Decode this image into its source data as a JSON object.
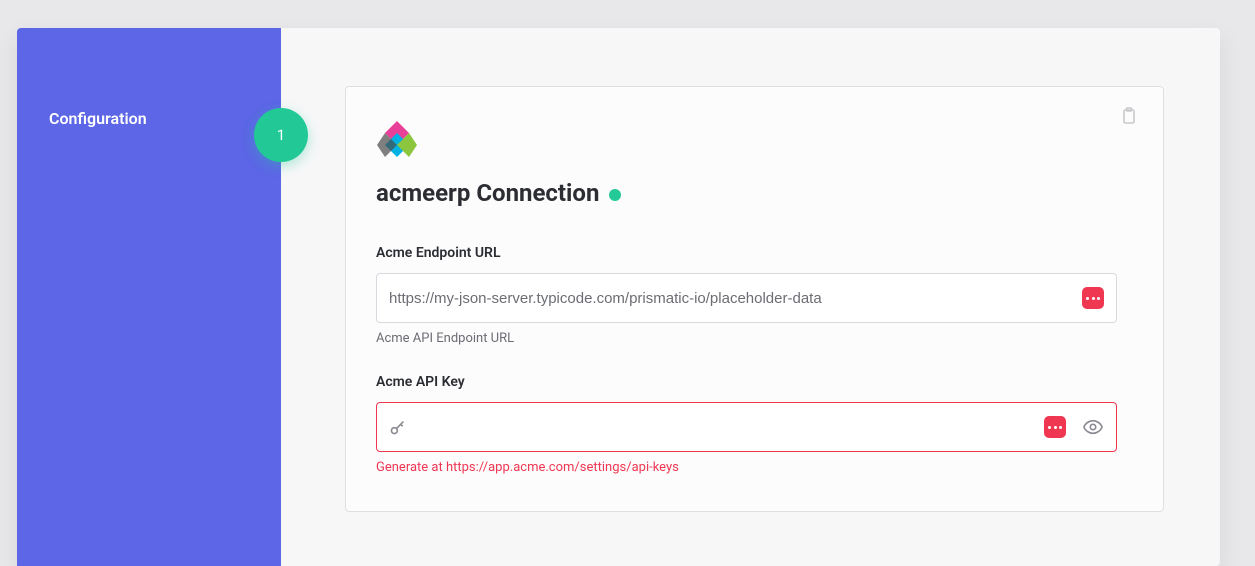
{
  "sidebar": {
    "step_label": "Configuration",
    "step_number": "1"
  },
  "card": {
    "title": "acmeerp Connection",
    "status": "connected",
    "fields": {
      "endpoint": {
        "label": "Acme Endpoint URL",
        "value": "https://my-json-server.typicode.com/prismatic-io/placeholder-data",
        "helper": "Acme API Endpoint URL"
      },
      "apikey": {
        "label": "Acme API Key",
        "value": "",
        "helper": "Generate at https://app.acme.com/settings/api-keys"
      }
    }
  }
}
